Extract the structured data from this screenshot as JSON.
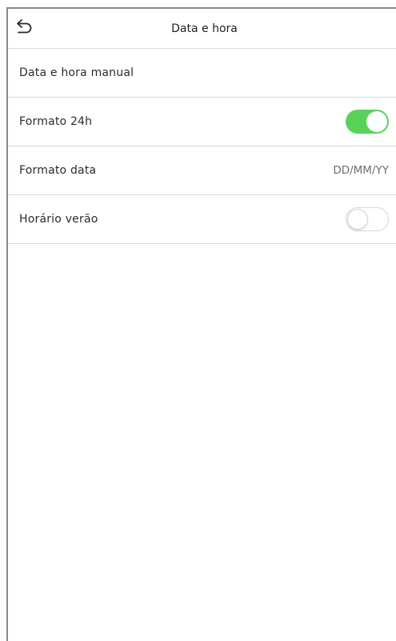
{
  "header": {
    "title": "Data e hora",
    "back_icon": "back-arrow-icon"
  },
  "settings": {
    "manual_datetime": {
      "label": "Data e hora manual"
    },
    "format_24h": {
      "label": "Formato 24h",
      "enabled": true
    },
    "date_format": {
      "label": "Formato data",
      "value": "DD/MM/YY"
    },
    "daylight_saving": {
      "label": "Horário verão",
      "enabled": false
    }
  },
  "colors": {
    "toggle_on": "#5ad25a",
    "toggle_off": "#ffffff",
    "divider": "#d9d9d9"
  }
}
